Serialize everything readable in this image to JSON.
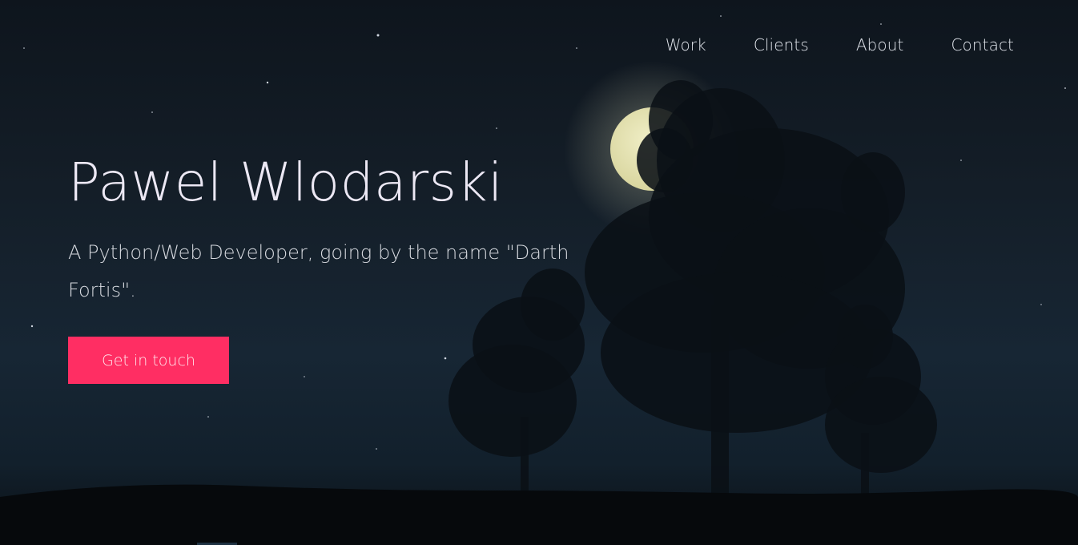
{
  "nav": {
    "items": [
      {
        "label": "Work"
      },
      {
        "label": "Clients"
      },
      {
        "label": "About"
      },
      {
        "label": "Contact"
      }
    ]
  },
  "hero": {
    "title": "Pawel Wlodarski",
    "subtitle": "A Python/Web Developer, going by the name \"Darth Fortis\".",
    "cta_label": "Get in touch"
  },
  "colors": {
    "accent": "#ff2e63",
    "sky_top": "#0e151d",
    "sky_mid": "#172634",
    "moon": "#e8e6bb",
    "text": "#ece8f4"
  },
  "icons": {
    "moon": "moon-icon",
    "trees": "tree-silhouette"
  }
}
